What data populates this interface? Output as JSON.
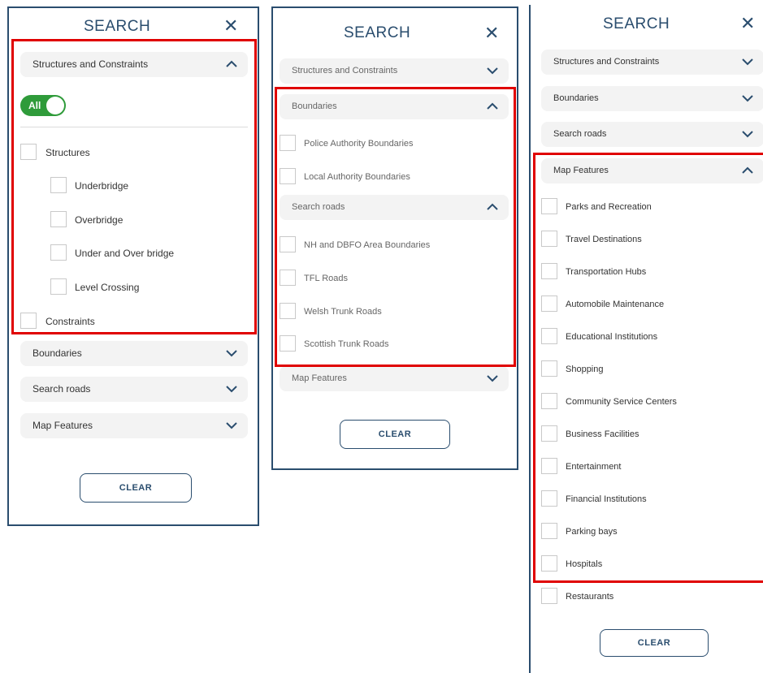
{
  "colors": {
    "accent": "#2a4d6e",
    "toggle_on": "#2f9b3a",
    "highlight": "#e00000"
  },
  "panel1": {
    "title": "SEARCH",
    "close": "✕",
    "sections": {
      "structures": "Structures and Constraints",
      "boundaries": "Boundaries",
      "search_roads": "Search roads",
      "map_features": "Map Features"
    },
    "toggle_label": "All",
    "items": {
      "structures": "Structures",
      "underbridge": "Underbridge",
      "overbridge": "Overbridge",
      "under_over": "Under and Over bridge",
      "level_crossing": "Level Crossing",
      "constraints": "Constraints"
    },
    "clear": "CLEAR"
  },
  "panel2": {
    "title": "SEARCH",
    "close": "✕",
    "sections": {
      "structures": "Structures and Constraints",
      "boundaries": "Boundaries",
      "search_roads": "Search roads",
      "map_features": "Map Features"
    },
    "boundary_items": [
      "Police Authority Boundaries",
      "Local Authority Boundaries"
    ],
    "road_items": [
      "NH and DBFO Area Boundaries",
      "TFL Roads",
      "Welsh Trunk Roads",
      "Scottish Trunk Roads"
    ],
    "clear": "CLEAR"
  },
  "panel3": {
    "title": "SEARCH",
    "close": "✕",
    "sections": {
      "structures": "Structures and Constraints",
      "boundaries": "Boundaries",
      "search_roads": "Search roads",
      "map_features": "Map Features"
    },
    "feature_items": [
      "Parks and Recreation",
      "Travel Destinations",
      "Transportation Hubs",
      "Automobile Maintenance",
      "Educational Institutions",
      "Shopping",
      "Community Service Centers",
      "Business Facilities",
      "Entertainment",
      "Financial Institutions",
      "Parking bays",
      "Hospitals",
      "Restaurants"
    ],
    "clear": "CLEAR"
  }
}
